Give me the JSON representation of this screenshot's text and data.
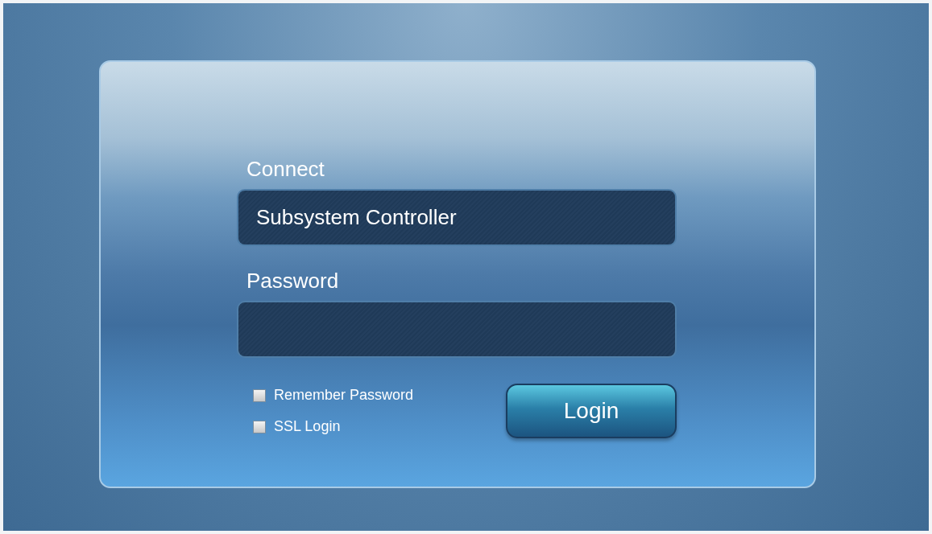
{
  "connect": {
    "label": "Connect",
    "value": "Subsystem Controller"
  },
  "password": {
    "label": "Password"
  },
  "options": [
    {
      "label": "Remember Password",
      "checked": false
    },
    {
      "label": "SSL Login",
      "checked": false
    }
  ],
  "login_button": {
    "label": "Login"
  }
}
